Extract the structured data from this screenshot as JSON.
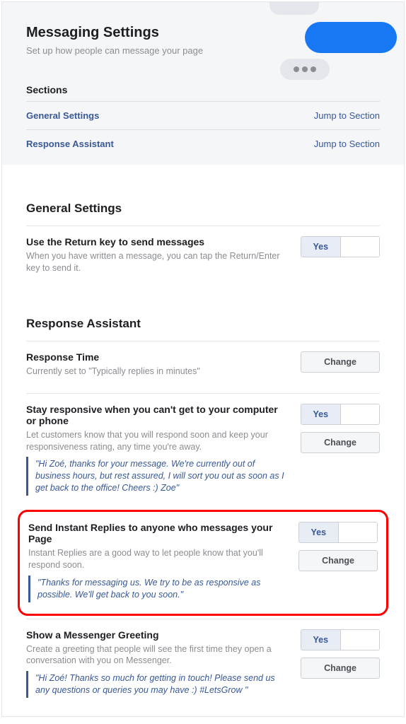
{
  "header": {
    "title": "Messaging Settings",
    "subtitle": "Set up how people can message your page"
  },
  "sections_nav": {
    "label": "Sections",
    "jump_label": "Jump to Section",
    "items": [
      {
        "label": "General Settings"
      },
      {
        "label": "Response Assistant"
      }
    ]
  },
  "general": {
    "heading": "General Settings",
    "return_key": {
      "title": "Use the Return key to send messages",
      "sub": "When you have written a message, you can tap the Return/Enter key to send it.",
      "toggle_yes": "Yes"
    }
  },
  "assistant": {
    "heading": "Response Assistant",
    "response_time": {
      "title": "Response Time",
      "sub": "Currently set to \"Typically replies in minutes\"",
      "change": "Change"
    },
    "stay_responsive": {
      "title": "Stay responsive when you can't get to your computer or phone",
      "sub": "Let customers know that you will respond soon and keep your responsiveness rating, any time you're away.",
      "quote": "\"Hi Zoé, thanks for your message. We're currently out of business hours, but rest assured, I will sort you out as soon as I get back to the office! Cheers :) Zoe\"",
      "toggle_yes": "Yes",
      "change": "Change"
    },
    "instant_replies": {
      "title": "Send Instant Replies to anyone who messages your Page",
      "sub": "Instant Replies are a good way to let people know that you'll respond soon.",
      "quote": "\"Thanks for messaging us. We try to be as responsive as possible. We'll get back to you soon.\"",
      "toggle_yes": "Yes",
      "change": "Change"
    },
    "greeting": {
      "title": "Show a Messenger Greeting",
      "sub": "Create a greeting that people will see the first time they open a conversation with you on Messenger.",
      "quote": "\"Hi Zoé! Thanks so much for getting in touch! Please send us any questions or queries you may have :) #LetsGrow \"",
      "toggle_yes": "Yes",
      "change": "Change"
    }
  }
}
